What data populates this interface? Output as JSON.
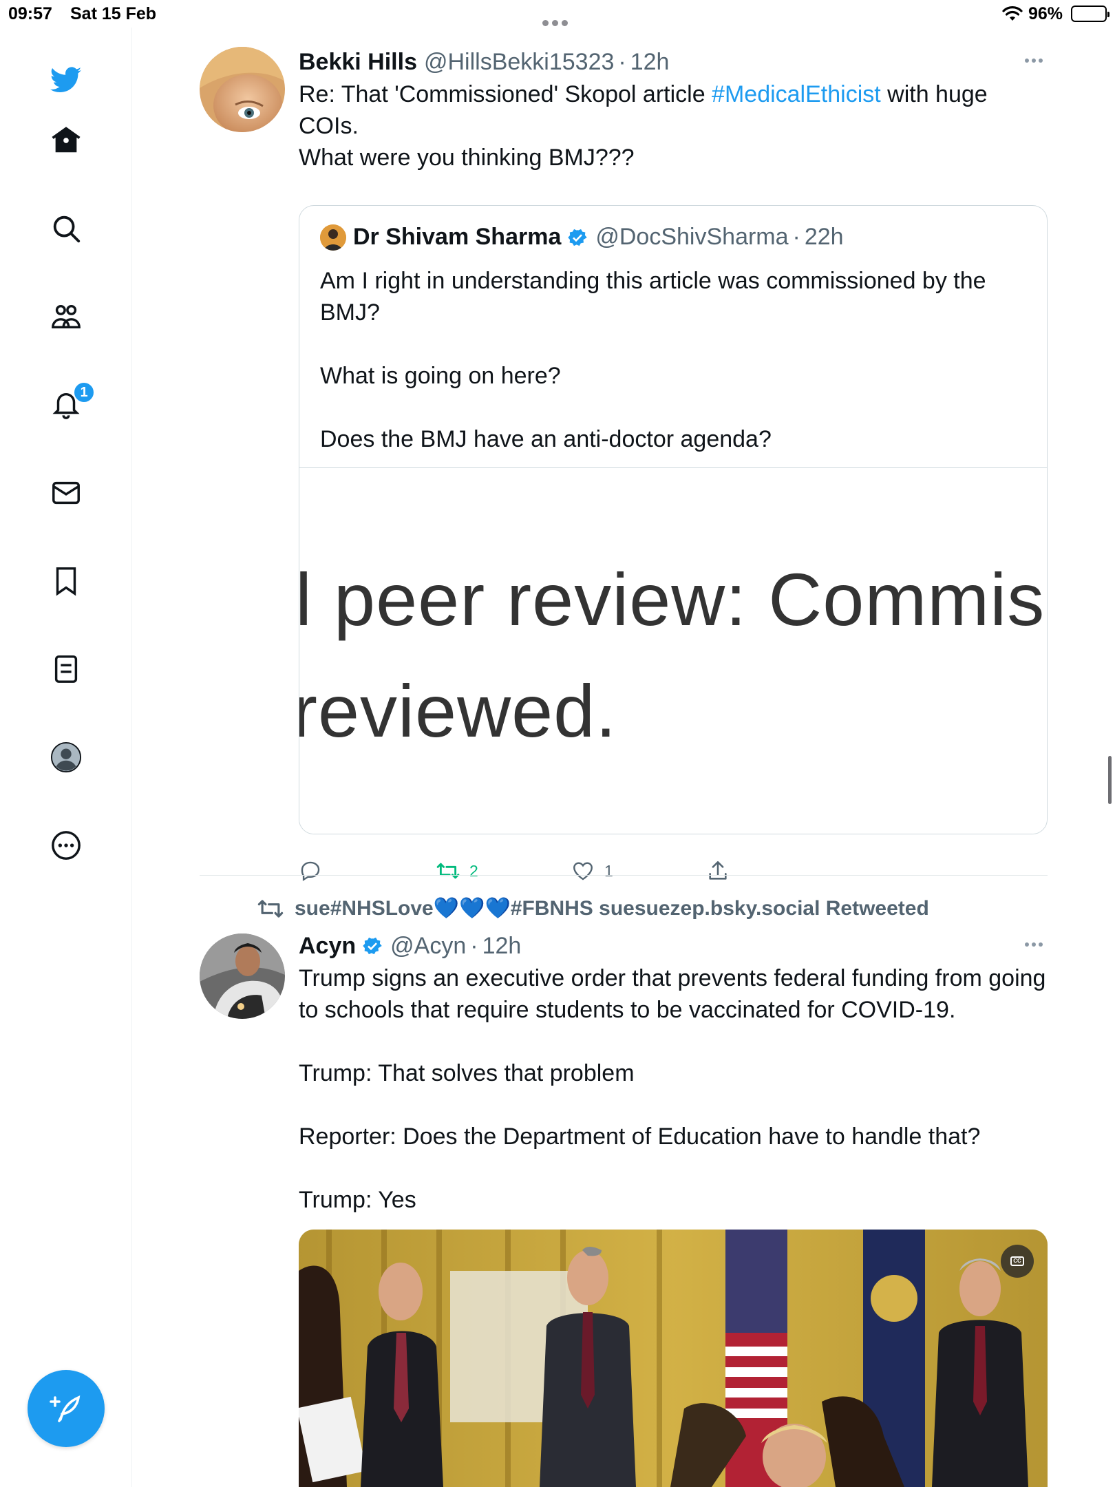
{
  "status_bar": {
    "time": "09:57",
    "date": "Sat 15 Feb",
    "battery": "96%"
  },
  "sidebar": {
    "items": [
      {
        "name": "twitter-logo",
        "label": ""
      },
      {
        "name": "home",
        "label": ""
      },
      {
        "name": "explore",
        "label": ""
      },
      {
        "name": "communities",
        "label": ""
      },
      {
        "name": "notifications",
        "label": ""
      },
      {
        "name": "messages",
        "label": ""
      },
      {
        "name": "bookmarks",
        "label": ""
      },
      {
        "name": "lists",
        "label": ""
      },
      {
        "name": "profile",
        "label": ""
      },
      {
        "name": "more",
        "label": ""
      }
    ],
    "notifications_badge": "1",
    "accent": "#1d9bf0"
  },
  "tweets": [
    {
      "name": "Bekki Hills",
      "handle": "@HillsBekki15323",
      "sep": "·",
      "age": "12h",
      "text_before": "Re: That 'Commissioned' Skopol article ",
      "hashtag": "#MedicalEthicist",
      "text_after": " with huge COIs.\nWhat were you thinking BMJ???",
      "quote": {
        "name": "Dr Shivam Sharma",
        "handle": "@DocShivSharma",
        "sep": "·",
        "age": "22h",
        "text": "Am I right in understanding this article was commissioned by the BMJ?\n\nWhat is going on here?\n\nDoes the BMJ have an anti-doctor agenda?",
        "image_line1": "l peer review: Commissio",
        "image_line2": "reviewed."
      },
      "actions": {
        "reply": "",
        "retweet": "2",
        "like": "1",
        "share": ""
      }
    },
    {
      "retweeted_by": "sue#NHSLove💙💙💙#FBNHS suesuezep.bsky.social Retweeted",
      "name": "Acyn",
      "handle": "@Acyn",
      "sep": "·",
      "age": "12h",
      "text": "Trump signs an executive order that prevents federal funding from going to schools that require students to be vaccinated for COVID-19.\n\nTrump: That solves that problem\n\nReporter: Does the Department of Education have to handle that?\n\nTrump: Yes",
      "media_caption_icon": "closed-captions-icon"
    }
  ]
}
